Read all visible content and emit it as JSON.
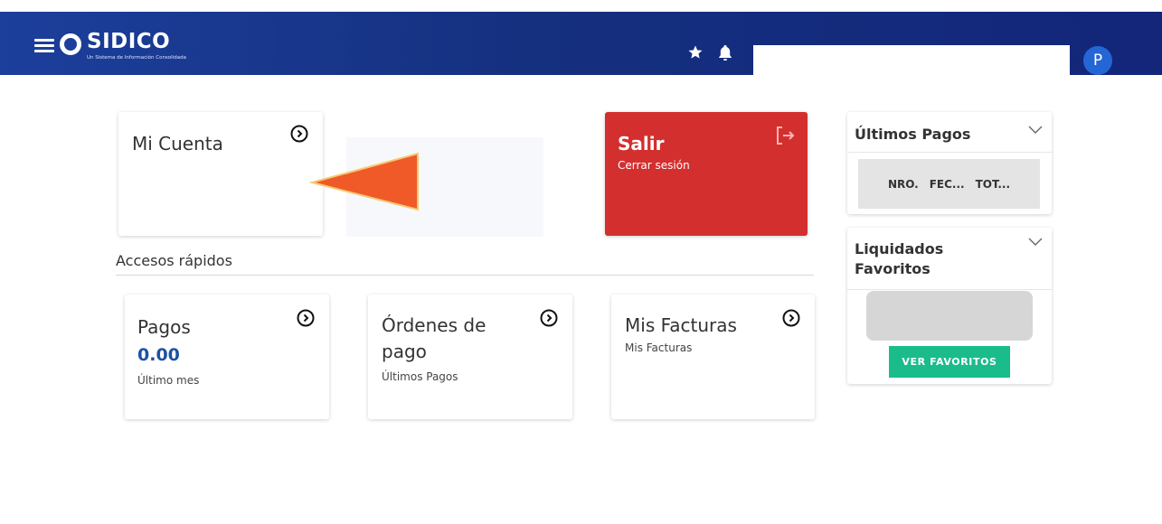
{
  "header": {
    "brand_title": "SIDICO",
    "brand_subtitle": "Un Sistema de Información Consolidada",
    "icons": {
      "favorites": "star-icon",
      "notifications": "bell-icon"
    },
    "search": {
      "value": "",
      "placeholder": ""
    },
    "user_initial": "P",
    "bg_color": "#1c3f9c"
  },
  "cards": {
    "mi_cuenta": {
      "title": "Mi Cuenta"
    },
    "salir": {
      "title": "Salir",
      "subtitle": "Cerrar sesión",
      "color": "#d32f2f"
    }
  },
  "quick_access": {
    "title": "Accesos rápidos",
    "items": [
      {
        "title": "Pagos",
        "value": "0.00",
        "subtitle": "Último mes"
      },
      {
        "title": "Órdenes de pago",
        "subtitle": "Últimos Pagos"
      },
      {
        "title": "Mis Facturas",
        "subtitle": "Mis Facturas"
      }
    ]
  },
  "sidebar": {
    "ultimos_pagos": {
      "title": "Últimos Pagos",
      "columns": [
        "NRO.",
        "FEC...",
        "TOT..."
      ]
    },
    "liquidados": {
      "title": "Liquidados Favoritos",
      "button_label": "VER FAVORITOS",
      "button_color": "#1abc8c"
    }
  },
  "annotation": {
    "arrow_color": "#f05a28"
  }
}
